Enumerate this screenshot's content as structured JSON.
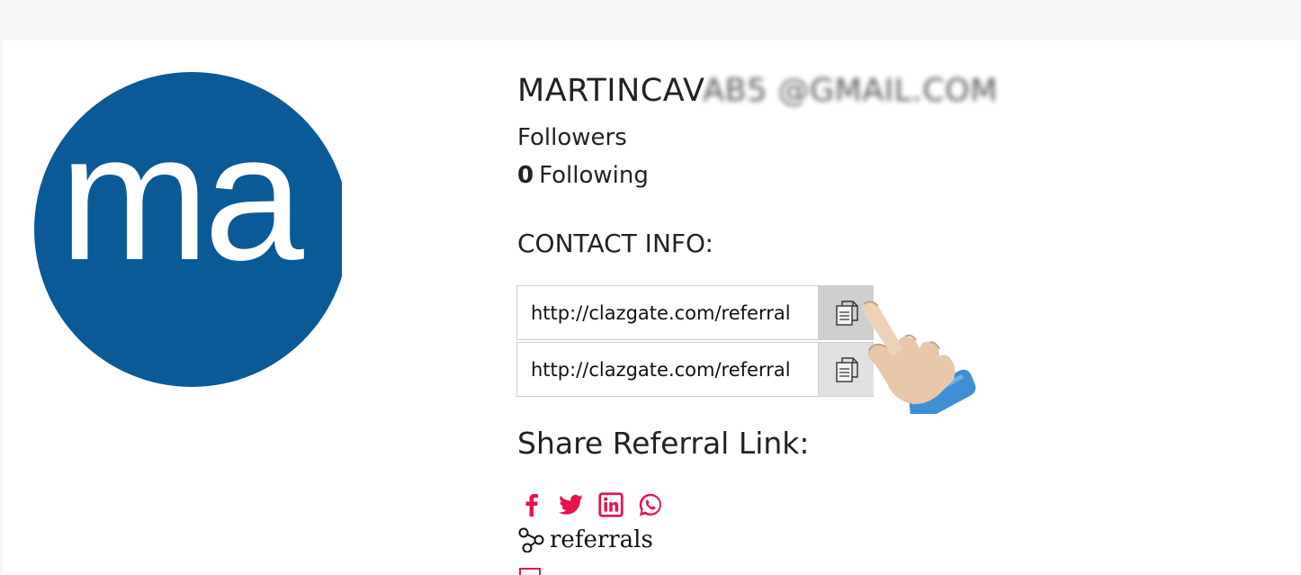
{
  "profile": {
    "avatar_text": "ma",
    "email_visible": "MARTINCAV",
    "email_obscured": "AB5 @GMAIL.COM",
    "followers_label": "Followers",
    "following_count": "0",
    "following_label": "Following"
  },
  "contact": {
    "title": "CONTACT INFO:",
    "links": [
      {
        "value": "http://clazgate.com/referral"
      },
      {
        "value": "http://clazgate.com/referral"
      }
    ]
  },
  "share": {
    "title": "Share Referral Link:",
    "icons": [
      "facebook-icon",
      "twitter-icon",
      "linkedin-icon",
      "whatsapp-icon"
    ],
    "referrals_label": "referrals"
  },
  "colors": {
    "avatar_bg": "#0a5a97",
    "social_accent": "#e4154b",
    "copy_button_bg": "#e0e0e0"
  }
}
